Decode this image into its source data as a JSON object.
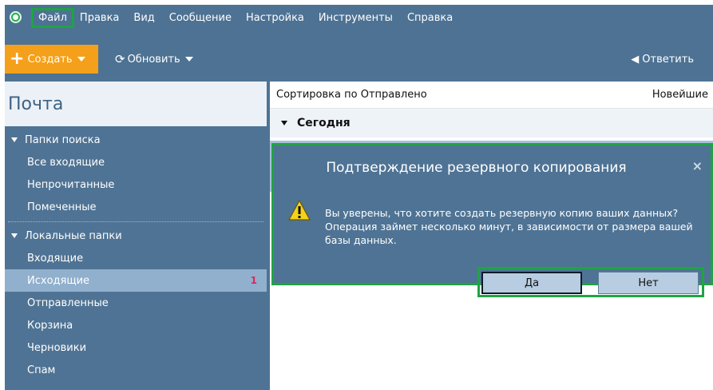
{
  "menu": {
    "items": [
      "Файл",
      "Правка",
      "Вид",
      "Сообщение",
      "Настройка",
      "Инструменты",
      "Справка"
    ]
  },
  "toolbar": {
    "create_label": "Создать",
    "refresh_label": "Обновить",
    "reply_label": "Ответить"
  },
  "sidebar": {
    "title": "Почта",
    "search_folders_label": "Папки поиска",
    "search_folders": [
      "Все входящие",
      "Непрочитанные",
      "Помеченные"
    ],
    "local_folders_label": "Локальные папки",
    "local_folders": [
      {
        "label": "Входящие",
        "count": ""
      },
      {
        "label": "Исходящие",
        "count": "1"
      },
      {
        "label": "Отправленные",
        "count": ""
      },
      {
        "label": "Корзина",
        "count": ""
      },
      {
        "label": "Черновики",
        "count": ""
      },
      {
        "label": "Спам",
        "count": ""
      }
    ]
  },
  "main": {
    "sort_label": "Сортировка по Отправлено",
    "order_label": "Новейшие",
    "group_label": "Сегодня"
  },
  "dialog": {
    "title": "Подтверждение резервного копирования",
    "message": "Вы уверены, что хотите создать резервную копию ваших данных? Операция займет несколько минут, в зависимости от размера вашей базы данных.",
    "yes_label": "Да",
    "no_label": "Нет",
    "close_glyph": "×"
  },
  "colors": {
    "chrome": "#4f7394",
    "accent_orange": "#f5a01a",
    "highlight_green": "#1fa443",
    "selected_item": "#90b0cd",
    "badge_red": "#e0255a"
  },
  "icons": [
    "app-logo-icon",
    "plus-icon",
    "refresh-icon",
    "reply-arrow-icon",
    "warning-icon",
    "close-icon"
  ]
}
